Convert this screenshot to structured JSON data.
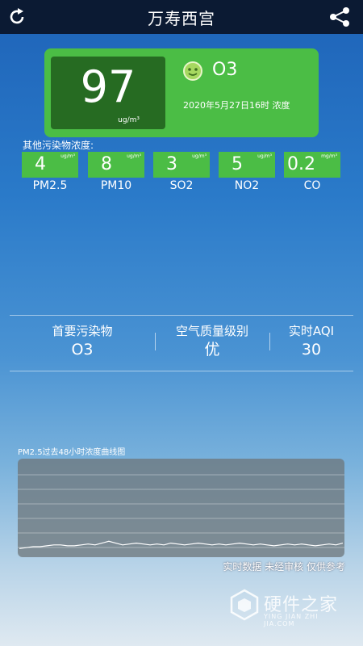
{
  "header": {
    "title": "万寿西宫",
    "refresh_icon": "refresh-icon",
    "share_icon": "share-icon"
  },
  "main": {
    "aqi_value": "97",
    "aqi_unit": "ug/m³",
    "primary_pollutant": "O3",
    "timestamp": "2020年5月27日16时 浓度",
    "face_icon": "smile-face-icon",
    "card_color": "#4bbd45",
    "box_color": "#266b22"
  },
  "others": {
    "label": "其他污染物浓度:",
    "items": [
      {
        "value": "4",
        "unit": "ug/m³",
        "name": "PM2.5"
      },
      {
        "value": "8",
        "unit": "ug/m³",
        "name": "PM10"
      },
      {
        "value": "3",
        "unit": "ug/m³",
        "name": "SO2"
      },
      {
        "value": "5",
        "unit": "ug/m³",
        "name": "NO2"
      },
      {
        "value": "0.2",
        "unit": "mg/m³",
        "name": "CO"
      }
    ]
  },
  "stats": {
    "primary_label": "首要污染物",
    "primary_value": "O3",
    "level_label": "空气质量级别",
    "level_value": "优",
    "aqi_label": "实时AQI",
    "aqi_value": "30"
  },
  "chart": {
    "title": "PM2.5过去48小时浓度曲线图",
    "disclaimer": "实时数据 未经审核 仅供参考"
  },
  "chart_data": {
    "type": "line",
    "title": "PM2.5过去48小时浓度曲线图",
    "xlabel": "",
    "ylabel": "",
    "grid": true,
    "series": [
      {
        "values": [
          6,
          7,
          8,
          8,
          9,
          10,
          10,
          9,
          9,
          10,
          11,
          10,
          12,
          14,
          12,
          10,
          11,
          12,
          11,
          10,
          11,
          10,
          12,
          11,
          10,
          11,
          12,
          11,
          10,
          11,
          10,
          11,
          12,
          11,
          10,
          11,
          10,
          9,
          10,
          11,
          10,
          11,
          10,
          9,
          10,
          11,
          10,
          12
        ]
      }
    ]
  },
  "watermark": {
    "text": "硬件之家",
    "sub": "YING JIAN ZHI JIA.COM"
  }
}
